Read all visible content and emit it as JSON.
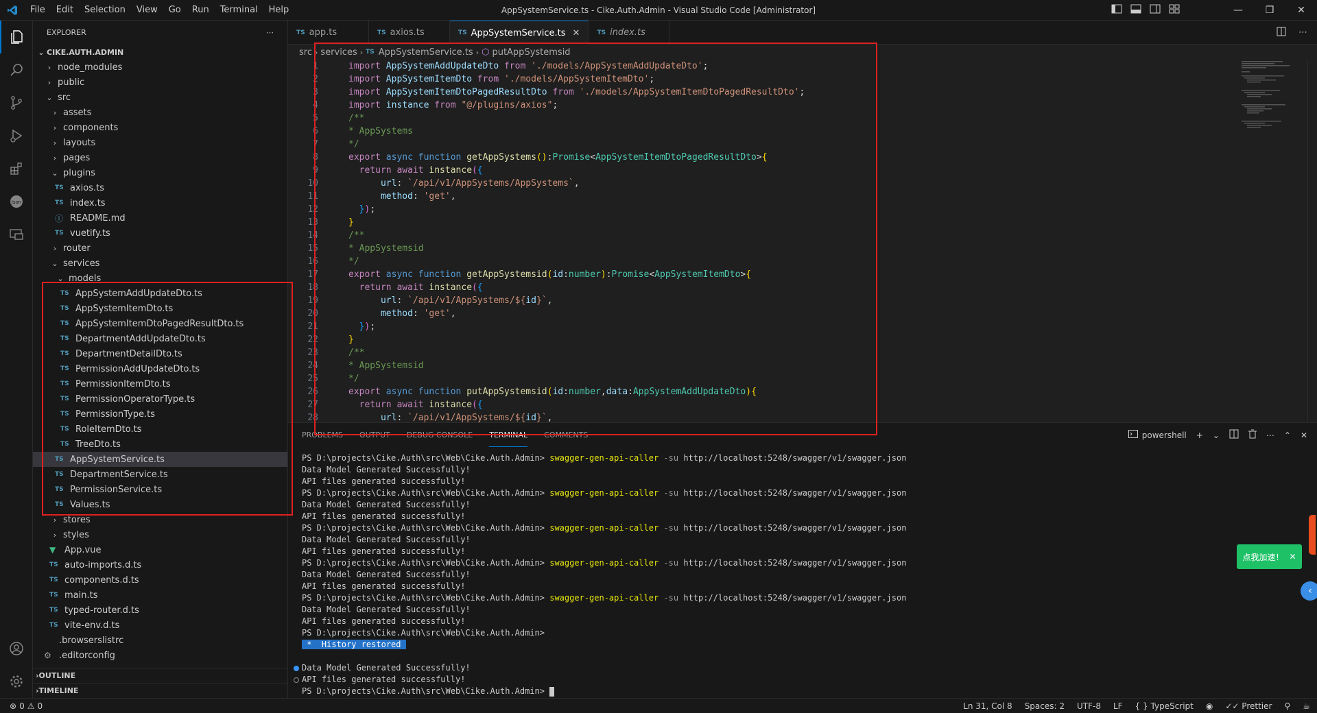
{
  "window": {
    "title": "AppSystemService.ts - Cike.Auth.Admin - Visual Studio Code [Administrator]",
    "menu": [
      "File",
      "Edit",
      "Selection",
      "View",
      "Go",
      "Run",
      "Terminal",
      "Help"
    ]
  },
  "sidebar": {
    "header": "EXPLORER",
    "root": "CIKE.AUTH.ADMIN",
    "tree": [
      {
        "label": "node_modules",
        "kind": "folder-closed",
        "depth": 1
      },
      {
        "label": "public",
        "kind": "folder-closed",
        "depth": 1
      },
      {
        "label": "src",
        "kind": "folder-open",
        "depth": 1
      },
      {
        "label": "assets",
        "kind": "folder-closed",
        "depth": 2
      },
      {
        "label": "components",
        "kind": "folder-closed",
        "depth": 2
      },
      {
        "label": "layouts",
        "kind": "folder-closed",
        "depth": 2
      },
      {
        "label": "pages",
        "kind": "folder-closed",
        "depth": 2
      },
      {
        "label": "plugins",
        "kind": "folder-open",
        "depth": 2
      },
      {
        "label": "axios.ts",
        "kind": "ts",
        "depth": 3
      },
      {
        "label": "index.ts",
        "kind": "ts",
        "depth": 3
      },
      {
        "label": "README.md",
        "kind": "info",
        "depth": 3
      },
      {
        "label": "vuetify.ts",
        "kind": "ts",
        "depth": 3
      },
      {
        "label": "router",
        "kind": "folder-closed",
        "depth": 2
      },
      {
        "label": "services",
        "kind": "folder-open",
        "depth": 2
      },
      {
        "label": "models",
        "kind": "folder-open",
        "depth": 3
      },
      {
        "label": "AppSystemAddUpdateDto.ts",
        "kind": "ts",
        "depth": 4
      },
      {
        "label": "AppSystemItemDto.ts",
        "kind": "ts",
        "depth": 4
      },
      {
        "label": "AppSystemItemDtoPagedResultDto.ts",
        "kind": "ts",
        "depth": 4
      },
      {
        "label": "DepartmentAddUpdateDto.ts",
        "kind": "ts",
        "depth": 4
      },
      {
        "label": "DepartmentDetailDto.ts",
        "kind": "ts",
        "depth": 4
      },
      {
        "label": "PermissionAddUpdateDto.ts",
        "kind": "ts",
        "depth": 4
      },
      {
        "label": "PermissionItemDto.ts",
        "kind": "ts",
        "depth": 4
      },
      {
        "label": "PermissionOperatorType.ts",
        "kind": "ts",
        "depth": 4
      },
      {
        "label": "PermissionType.ts",
        "kind": "ts",
        "depth": 4
      },
      {
        "label": "RoleItemDto.ts",
        "kind": "ts",
        "depth": 4
      },
      {
        "label": "TreeDto.ts",
        "kind": "ts",
        "depth": 4
      },
      {
        "label": "AppSystemService.ts",
        "kind": "ts",
        "depth": 3,
        "selected": true
      },
      {
        "label": "DepartmentService.ts",
        "kind": "ts",
        "depth": 3
      },
      {
        "label": "PermissionService.ts",
        "kind": "ts",
        "depth": 3
      },
      {
        "label": "Values.ts",
        "kind": "ts",
        "depth": 3
      },
      {
        "label": "stores",
        "kind": "folder-closed",
        "depth": 2
      },
      {
        "label": "styles",
        "kind": "folder-closed",
        "depth": 2
      },
      {
        "label": "App.vue",
        "kind": "vue",
        "depth": 2
      },
      {
        "label": "auto-imports.d.ts",
        "kind": "ts",
        "depth": 2
      },
      {
        "label": "components.d.ts",
        "kind": "ts",
        "depth": 2
      },
      {
        "label": "main.ts",
        "kind": "ts",
        "depth": 2
      },
      {
        "label": "typed-router.d.ts",
        "kind": "ts",
        "depth": 2
      },
      {
        "label": "vite-env.d.ts",
        "kind": "ts",
        "depth": 2
      },
      {
        "label": ".browserslistrc",
        "kind": "plain",
        "depth": 1
      },
      {
        "label": ".editorconfig",
        "kind": "gear",
        "depth": 1
      }
    ],
    "outline": "OUTLINE",
    "timeline": "TIMELINE"
  },
  "tabs": [
    {
      "label": "app.ts",
      "active": false,
      "italic": false
    },
    {
      "label": "axios.ts",
      "active": false,
      "italic": false
    },
    {
      "label": "AppSystemService.ts",
      "active": true,
      "italic": false
    },
    {
      "label": "index.ts",
      "active": false,
      "italic": true
    }
  ],
  "breadcrumb": {
    "parts": [
      "src",
      "services"
    ],
    "file": "AppSystemService.ts",
    "symbol": "putAppSystemsid"
  },
  "editor": {
    "lines": [
      [
        [
          "kw",
          "import "
        ],
        [
          "id",
          "AppSystemAddUpdateDto "
        ],
        [
          "kw",
          "from "
        ],
        [
          "str",
          "'./models/AppSystemAddUpdateDto'"
        ],
        [
          "pn",
          ";"
        ]
      ],
      [
        [
          "kw",
          "import "
        ],
        [
          "id",
          "AppSystemItemDto "
        ],
        [
          "kw",
          "from "
        ],
        [
          "str",
          "'./models/AppSystemItemDto'"
        ],
        [
          "pn",
          ";"
        ]
      ],
      [
        [
          "kw",
          "import "
        ],
        [
          "id",
          "AppSystemItemDtoPagedResultDto "
        ],
        [
          "kw",
          "from "
        ],
        [
          "str",
          "'./models/AppSystemItemDtoPagedResultDto'"
        ],
        [
          "pn",
          ";"
        ]
      ],
      [
        [
          "kw",
          "import "
        ],
        [
          "id",
          "instance "
        ],
        [
          "kw",
          "from "
        ],
        [
          "str",
          "\"@/plugins/axios\""
        ],
        [
          "pn",
          ";"
        ]
      ],
      [
        [
          "cm",
          "/**"
        ]
      ],
      [
        [
          "cm",
          "* AppSystems"
        ]
      ],
      [
        [
          "cm",
          "*/"
        ]
      ],
      [
        [
          "kw",
          "export "
        ],
        [
          "kw2",
          "async function "
        ],
        [
          "fn",
          "getAppSystems"
        ],
        [
          "br1",
          "()"
        ],
        [
          "pn",
          ":"
        ],
        [
          "ty",
          "Promise"
        ],
        [
          "pn",
          "<"
        ],
        [
          "ty",
          "AppSystemItemDtoPagedResultDto"
        ],
        [
          "pn",
          ">"
        ],
        [
          "br1",
          "{"
        ]
      ],
      [
        [
          "pn",
          "  "
        ],
        [
          "kw",
          "return await "
        ],
        [
          "fn",
          "instance"
        ],
        [
          "br2",
          "("
        ],
        [
          "br3",
          "{"
        ]
      ],
      [
        [
          "pn",
          "      "
        ],
        [
          "id",
          "url"
        ],
        [
          "pn",
          ": "
        ],
        [
          "str",
          "`/api/v1/AppSystems/AppSystems`"
        ],
        [
          "pn",
          ","
        ]
      ],
      [
        [
          "pn",
          "      "
        ],
        [
          "id",
          "method"
        ],
        [
          "pn",
          ": "
        ],
        [
          "str",
          "'get'"
        ],
        [
          "pn",
          ","
        ]
      ],
      [
        [
          "pn",
          "  "
        ],
        [
          "br3",
          "}"
        ],
        [
          "br2",
          ")"
        ],
        [
          "pn",
          ";"
        ]
      ],
      [
        [
          "br1",
          "}"
        ]
      ],
      [
        [
          "cm",
          "/**"
        ]
      ],
      [
        [
          "cm",
          "* AppSystemsid"
        ]
      ],
      [
        [
          "cm",
          "*/"
        ]
      ],
      [
        [
          "kw",
          "export "
        ],
        [
          "kw2",
          "async function "
        ],
        [
          "fn",
          "getAppSystemsid"
        ],
        [
          "br1",
          "("
        ],
        [
          "id",
          "id"
        ],
        [
          "pn",
          ":"
        ],
        [
          "ty",
          "number"
        ],
        [
          "br1",
          ")"
        ],
        [
          "pn",
          ":"
        ],
        [
          "ty",
          "Promise"
        ],
        [
          "pn",
          "<"
        ],
        [
          "ty",
          "AppSystemItemDto"
        ],
        [
          "pn",
          ">"
        ],
        [
          "br1",
          "{"
        ]
      ],
      [
        [
          "pn",
          "  "
        ],
        [
          "kw",
          "return await "
        ],
        [
          "fn",
          "instance"
        ],
        [
          "br2",
          "("
        ],
        [
          "br3",
          "{"
        ]
      ],
      [
        [
          "pn",
          "      "
        ],
        [
          "id",
          "url"
        ],
        [
          "pn",
          ": "
        ],
        [
          "str",
          "`/api/v1/AppSystems/${"
        ],
        [
          "id",
          "id"
        ],
        [
          "str",
          "}`"
        ],
        [
          "pn",
          ","
        ]
      ],
      [
        [
          "pn",
          "      "
        ],
        [
          "id",
          "method"
        ],
        [
          "pn",
          ": "
        ],
        [
          "str",
          "'get'"
        ],
        [
          "pn",
          ","
        ]
      ],
      [
        [
          "pn",
          "  "
        ],
        [
          "br3",
          "}"
        ],
        [
          "br2",
          ")"
        ],
        [
          "pn",
          ";"
        ]
      ],
      [
        [
          "br1",
          "}"
        ]
      ],
      [
        [
          "cm",
          "/**"
        ]
      ],
      [
        [
          "cm",
          "* AppSystemsid"
        ]
      ],
      [
        [
          "cm",
          "*/"
        ]
      ],
      [
        [
          "kw",
          "export "
        ],
        [
          "kw2",
          "async function "
        ],
        [
          "fn",
          "putAppSystemsid"
        ],
        [
          "br1",
          "("
        ],
        [
          "id",
          "id"
        ],
        [
          "pn",
          ":"
        ],
        [
          "ty",
          "number"
        ],
        [
          "pn",
          ","
        ],
        [
          "id",
          "data"
        ],
        [
          "pn",
          ":"
        ],
        [
          "ty",
          "AppSystemAddUpdateDto"
        ],
        [
          "br1",
          ")"
        ],
        [
          "br1",
          "{"
        ]
      ],
      [
        [
          "pn",
          "  "
        ],
        [
          "kw",
          "return await "
        ],
        [
          "fn",
          "instance"
        ],
        [
          "br2",
          "("
        ],
        [
          "br3",
          "{"
        ]
      ],
      [
        [
          "pn",
          "      "
        ],
        [
          "id",
          "url"
        ],
        [
          "pn",
          ": "
        ],
        [
          "str",
          "`/api/v1/AppSystems/${"
        ],
        [
          "id",
          "id"
        ],
        [
          "str",
          "}`"
        ],
        [
          "pn",
          ","
        ]
      ]
    ]
  },
  "panel": {
    "tabs": [
      "PROBLEMS",
      "OUTPUT",
      "DEBUG CONSOLE",
      "TERMINAL",
      "COMMENTS"
    ],
    "active_tab": "TERMINAL",
    "shell": "powershell",
    "terminal": {
      "prompt": "PS D:\\projects\\Cike.Auth\\src\\Web\\Cike.Auth.Admin> ",
      "command": "swagger-gen-api-caller",
      "flag": " -su",
      "url": " http://localhost:5248/swagger/v1/swagger.json",
      "out1": "Data Model Generated Successfully!",
      "out2": "API files generated successfully!",
      "history": " * ",
      "history_label": " History restored "
    }
  },
  "status": {
    "errors": "0",
    "warnings": "0",
    "position": "Ln 31, Col 8",
    "spaces": "Spaces: 2",
    "encoding": "UTF-8",
    "eol": "LF",
    "language": "TypeScript",
    "formatter": "Prettier"
  },
  "floating": {
    "button_label": "点我加速！"
  },
  "colors": {
    "accent": "#0078d4",
    "annotation": "#e02020",
    "float_button": "#1fc167"
  }
}
